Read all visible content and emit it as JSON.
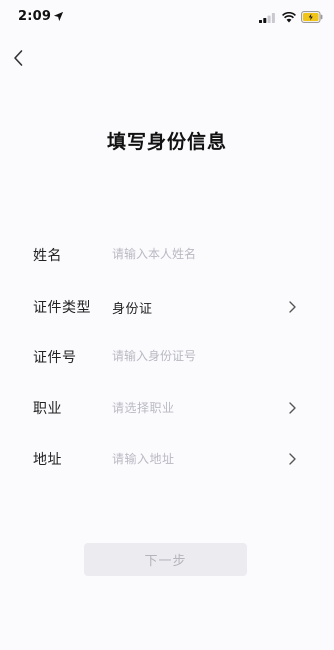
{
  "status_bar": {
    "time": "2:09"
  },
  "page": {
    "title": "填写身份信息"
  },
  "form": {
    "name": {
      "label": "姓名",
      "placeholder": "请输入本人姓名"
    },
    "id_type": {
      "label": "证件类型",
      "value": "身份证"
    },
    "id_number": {
      "label": "证件号",
      "placeholder": "请输入身份证号"
    },
    "occupation": {
      "label": "职业",
      "placeholder": "请选择职业"
    },
    "address": {
      "label": "地址",
      "placeholder": "请输入地址"
    }
  },
  "actions": {
    "next_label": "下一步"
  },
  "colors": {
    "background": "#fbfbfe",
    "text_primary": "#222222",
    "placeholder": "#b9b9c2",
    "button_disabled_bg": "#ececf0",
    "button_disabled_text": "#b4b4bc",
    "battery_fill": "#f0c419"
  }
}
